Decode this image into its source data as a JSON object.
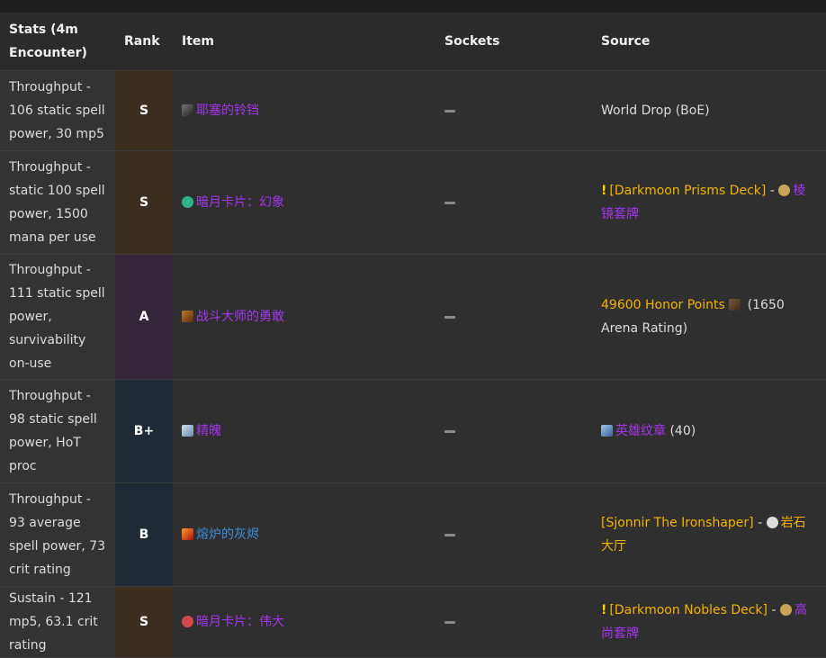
{
  "columns": {
    "stats": "Stats (4m Encounter)",
    "rank": "Rank",
    "item": "Item",
    "sockets": "Sockets",
    "source": "Source"
  },
  "rows": [
    {
      "stats": "Throughput - 106 static spell power, 30 mp5",
      "rank": "S",
      "item": "耶塞的铃铛",
      "item_icon": "bell-icon",
      "source_plain": "World Drop (BoE)"
    },
    {
      "stats": "Throughput - static 100 spell power, 1500 mana per use",
      "rank": "S",
      "item": "暗月卡片：幻象",
      "item_icon": "card-icon",
      "source_quest": "[Darkmoon Prisms Deck]",
      "source_sep": " - ",
      "source_item": "棱镜套牌"
    },
    {
      "stats": "Throughput - 111 static spell power, survivability on-use",
      "rank": "A",
      "item": "战斗大师的勇敢",
      "item_icon": "badge-icon",
      "source_gold": "49600 Honor Points",
      "source_plain": " (1650 Arena Rating)"
    },
    {
      "stats": "Throughput - 98 static spell power, HoT proc",
      "rank": "B+",
      "item": "精魄",
      "item_icon": "spirit-icon",
      "source_item": "英雄纹章",
      "source_plain": " (40)"
    },
    {
      "stats": "Throughput - 93 average spell power, 73 crit rating",
      "rank": "B",
      "item": "熔炉的灰烬",
      "item_icon": "ember-icon",
      "source_gold": "[Sjonnir The Ironshaper]",
      "source_sep": " - ",
      "source_gold2": "岩石大厅"
    },
    {
      "stats": "Sustain - 121 mp5, 63.1 crit rating",
      "rank": "S",
      "item": "暗月卡片：伟大",
      "item_icon": "card-icon",
      "source_quest": "[Darkmoon Nobles Deck]",
      "source_sep": " - ",
      "source_item": "高尚套牌"
    }
  ]
}
